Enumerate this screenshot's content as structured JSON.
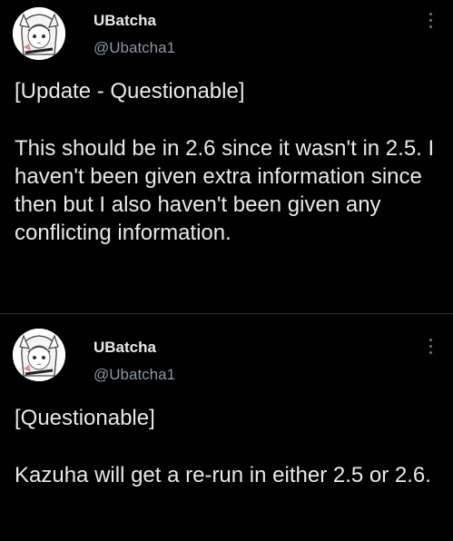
{
  "tweets": [
    {
      "author": {
        "display_name": "UBatcha",
        "handle": "@Ubatcha1",
        "avatar_icon": "anime-girl-avatar-icon"
      },
      "menu_icon": "more-options-icon",
      "tag": "[Update - Questionable]",
      "text": "This should be in 2.6 since it wasn't in 2.5. I haven't been given extra information since then but I also haven't been given any conflicting information."
    },
    {
      "author": {
        "display_name": "UBatcha",
        "handle": "@Ubatcha1",
        "avatar_icon": "anime-girl-avatar-icon"
      },
      "menu_icon": "more-options-icon",
      "tag": "[Questionable]",
      "text": "Kazuha will get a re-run in either 2.5 or 2.6."
    }
  ],
  "colors": {
    "background": "#000000",
    "text": "#e7e9ea",
    "secondary_text": "#8b98a5",
    "divider": "#2f3336"
  }
}
